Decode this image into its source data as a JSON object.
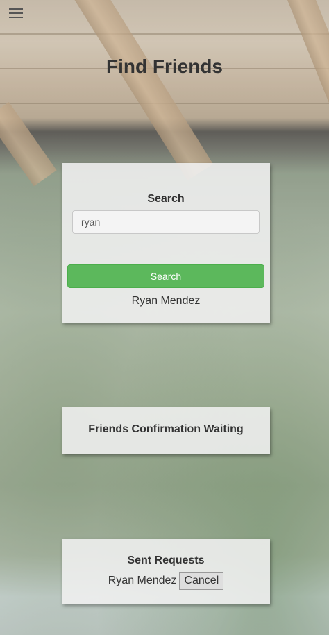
{
  "header": {
    "menu_icon": "hamburger-menu-icon",
    "title": "Find Friends"
  },
  "search_card": {
    "heading": "Search",
    "input_value": "ryan",
    "button_label": "Search",
    "button_color": "#5cb85c",
    "result": "Ryan Mendez"
  },
  "waiting_card": {
    "heading": "Friends Confirmation Waiting"
  },
  "sent_card": {
    "heading": "Sent Requests",
    "requests": [
      {
        "name": "Ryan Mendez",
        "cancel_label": "Cancel"
      }
    ]
  }
}
